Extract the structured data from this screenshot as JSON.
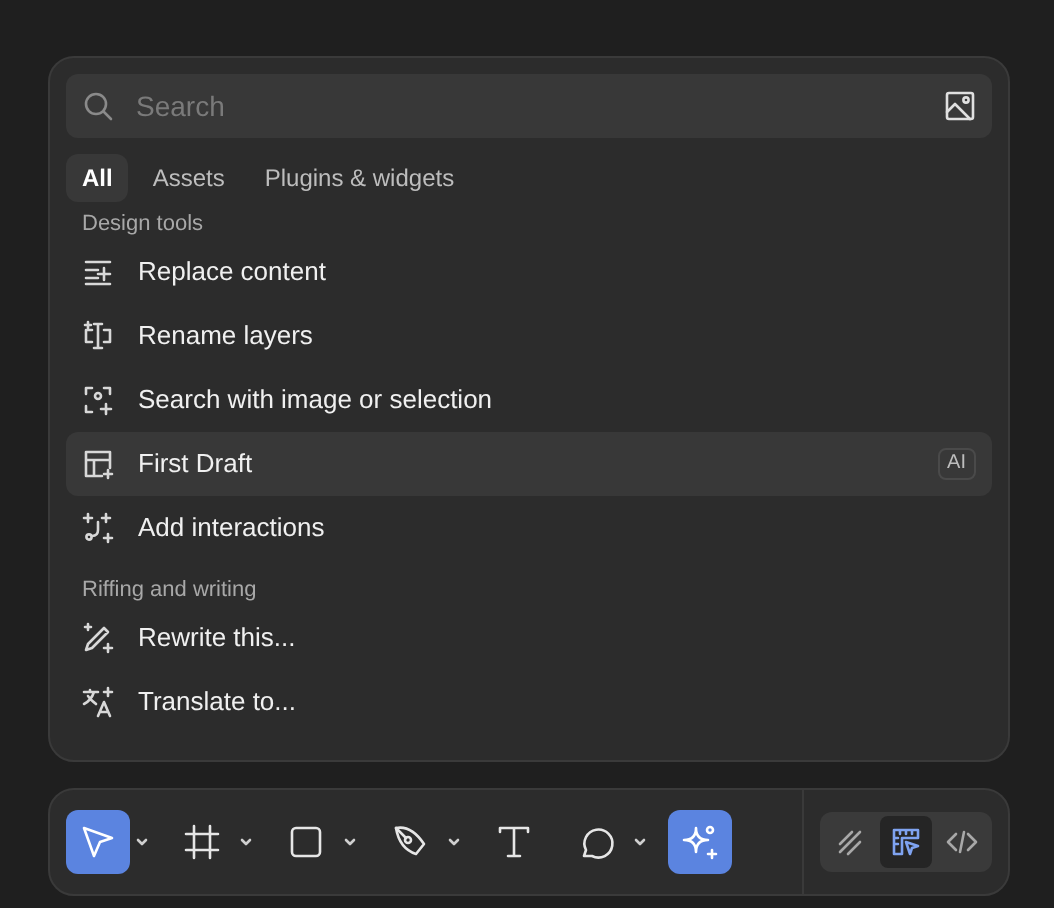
{
  "search": {
    "placeholder": "Search"
  },
  "tabs": [
    {
      "label": "All",
      "selected": true
    },
    {
      "label": "Assets",
      "selected": false
    },
    {
      "label": "Plugins & widgets",
      "selected": false
    }
  ],
  "sections": [
    {
      "heading": "Design tools",
      "items": [
        {
          "kind": "replace",
          "label": "Replace content",
          "selected": false
        },
        {
          "kind": "rename",
          "label": "Rename layers",
          "selected": false
        },
        {
          "kind": "search-image",
          "label": "Search with image or selection",
          "selected": false
        },
        {
          "kind": "draft",
          "label": "First Draft",
          "selected": true,
          "badge": "AI"
        },
        {
          "kind": "interactions",
          "label": "Add interactions",
          "selected": false
        }
      ]
    },
    {
      "heading": "Riffing and writing",
      "items": [
        {
          "kind": "rewrite",
          "label": "Rewrite this...",
          "selected": false
        },
        {
          "kind": "translate",
          "label": "Translate to...",
          "selected": false
        }
      ]
    }
  ],
  "toolbar": {
    "tools": [
      {
        "kind": "move",
        "selected": true,
        "menu": true
      },
      {
        "kind": "frame",
        "selected": false,
        "menu": true
      },
      {
        "kind": "shape",
        "selected": false,
        "menu": true
      },
      {
        "kind": "pen",
        "selected": false,
        "menu": true
      },
      {
        "kind": "text",
        "selected": false,
        "menu": false
      },
      {
        "kind": "comment",
        "selected": false,
        "menu": true
      },
      {
        "kind": "ai",
        "selected": true,
        "menu": false
      }
    ],
    "modes": [
      {
        "kind": "draw",
        "selected": false
      },
      {
        "kind": "design",
        "selected": true
      },
      {
        "kind": "dev",
        "selected": false
      }
    ]
  }
}
